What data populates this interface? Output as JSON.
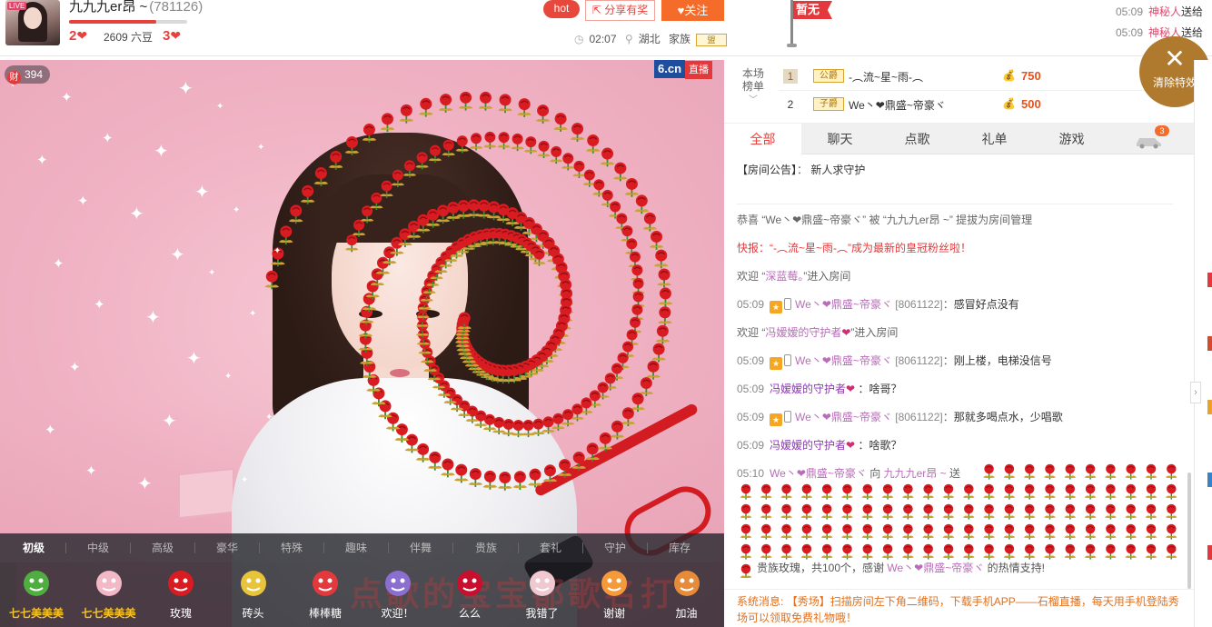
{
  "header": {
    "anchor_name": "九九九er昂 ~",
    "room_id": "(781126)",
    "level_progress": 0.74,
    "level_left": "2",
    "level_right": "3",
    "beans": "2609 六豆",
    "hot": "hot",
    "share": "分享有奖",
    "follow": "关注",
    "time": "02:07",
    "location": "湖北",
    "clan_label": "家族",
    "flag_text": "暂无",
    "ticker": [
      {
        "time": "05:09",
        "who": "神秘人",
        "rest": "送给"
      },
      {
        "time": "05:09",
        "who": "神秘人",
        "rest": "送给"
      }
    ]
  },
  "video": {
    "wealth_icon": "财",
    "wealth_count": "394",
    "watermark_brand": "6.cn",
    "watermark_live": "直播",
    "overlay_text": "点歌的宝宝都歌名打"
  },
  "gift_tabs": [
    "初级",
    "中级",
    "高级",
    "豪华",
    "特殊",
    "趣味",
    "伴舞",
    "贵族",
    "套礼",
    "守护",
    "库存"
  ],
  "gifts": [
    {
      "label": "七七美美美",
      "icon": "frog-icon",
      "gold": true
    },
    {
      "label": "七七美美美",
      "icon": "doll-icon",
      "gold": true
    },
    {
      "label": "玫瑰",
      "icon": "rose-icon",
      "gold": false
    },
    {
      "label": "砖头",
      "icon": "brick-icon",
      "gold": false
    },
    {
      "label": "棒棒糖",
      "icon": "lollipop-icon",
      "gold": false
    },
    {
      "label": "欢迎！",
      "icon": "balloon-icon",
      "gold": false
    },
    {
      "label": "么么",
      "icon": "lips-icon",
      "gold": false
    },
    {
      "label": "我错了",
      "icon": "cow-icon",
      "gold": false
    },
    {
      "label": "谢谢",
      "icon": "cat-icon",
      "gold": false
    },
    {
      "label": "加油",
      "icon": "cheer-icon",
      "gold": false
    }
  ],
  "rank": {
    "label_top": "本场",
    "label_bottom": "榜单",
    "rows": [
      {
        "no": "1",
        "badge": "公爵",
        "name": "-︵流~星~雨-︵",
        "amount": "750"
      },
      {
        "no": "2",
        "badge": "子爵",
        "name": "We丶❤鼎盛~帝豪ヾ",
        "amount": "500"
      }
    ]
  },
  "clear_effects": "清除特效",
  "chat_tabs": [
    "全部",
    "聊天",
    "点歌",
    "礼单",
    "游戏"
  ],
  "car_badge": "3",
  "chat": {
    "notice_label": "【房间公告】",
    "notice_sep": "：",
    "notice_text": "新人求守护",
    "l1_a": "恭喜 “We丶❤鼎盛~帝豪ヾ” 被 “九九九er昂 ~” 提拔为房间管理",
    "l2": "快报：“-︵流~星~雨-︵”成为最新的皇冠粉丝啦！",
    "l3_pre": "欢迎 “",
    "l3_name": "深蓝莓。",
    "l3_post": "”进入房间",
    "msgs": [
      {
        "time": "05:09",
        "name": "We丶❤鼎盛~帝豪ヾ",
        "id": "[8061122]",
        "text": "感冒好点没有"
      },
      {
        "time": "05:09",
        "name": "We丶❤鼎盛~帝豪ヾ",
        "id": "[8061122]",
        "text": "刚上楼，电梯没信号"
      },
      {
        "time": "05:09",
        "name": "We丶❤鼎盛~帝豪ヾ",
        "id": "[8061122]",
        "text": "那就多喝点水，少唱歌"
      }
    ],
    "welcome2_pre": "欢迎 “",
    "welcome2_name": "冯嫒嫒的守护者",
    "welcome2_post": "”进入房间",
    "guard_msgs": [
      {
        "time": "05:09",
        "name": "冯嫒嫒的守护者",
        "text": "：啥哥？"
      },
      {
        "time": "05:09",
        "name": "冯嫒嫒的守护者",
        "text": "：啥歌？"
      }
    ],
    "gift_time": "05:10",
    "gift_from": "We丶❤鼎盛~帝豪ヾ",
    "gift_to_word": "向",
    "gift_to": "九九九er昂 ~",
    "gift_send": "送",
    "rose_tail_pre": "贵族玫瑰，共100个，感谢",
    "rose_tail_name": "We丶❤鼎盛~帝豪ヾ",
    "rose_tail_post": "的热情支持!"
  },
  "system": {
    "label": "系统消息:",
    "text": "【秀场】扫描房间左下角二维码，下载手机APP——石榴直播，每天用手机登陆秀场可以领取免费礼物哦！"
  },
  "colors": {
    "accent": "#e5413d",
    "follow": "#f56b2a",
    "rose": "#d81c22"
  }
}
